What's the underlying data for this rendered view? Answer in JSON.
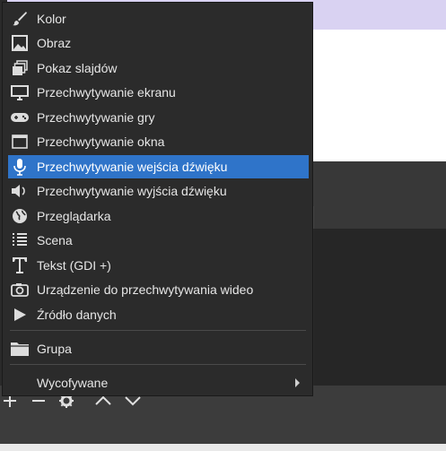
{
  "menu": {
    "items": [
      {
        "label": "Kolor",
        "icon": "brush-icon"
      },
      {
        "label": "Obraz",
        "icon": "image-icon"
      },
      {
        "label": "Pokaz slajdów",
        "icon": "slideshow-icon"
      },
      {
        "label": "Przechwytywanie ekranu",
        "icon": "monitor-icon"
      },
      {
        "label": "Przechwytywanie gry",
        "icon": "gamepad-icon"
      },
      {
        "label": "Przechwytywanie okna",
        "icon": "window-icon"
      },
      {
        "label": "Przechwytywanie wejścia dźwięku",
        "icon": "microphone-icon",
        "highlighted": true
      },
      {
        "label": "Przechwytywanie wyjścia dźwięku",
        "icon": "speaker-icon"
      },
      {
        "label": "Przeglądarka",
        "icon": "globe-icon"
      },
      {
        "label": "Scena",
        "icon": "list-icon"
      },
      {
        "label": "Tekst (GDI +)",
        "icon": "text-icon"
      },
      {
        "label": "Urządzenie do przechwytywania wideo",
        "icon": "camera-icon"
      },
      {
        "label": "Źródło danych",
        "icon": "play-icon"
      }
    ],
    "group": {
      "label": "Grupa",
      "icon": "folder-icon"
    },
    "deprecated": {
      "label": "Wycofywane"
    }
  },
  "colors": {
    "highlight": "#2f74c9",
    "menu_bg": "#2b2b2b",
    "text": "#e6e6e6"
  },
  "toolbar": {
    "icons": [
      "add-icon",
      "remove-icon",
      "settings-icon",
      "move-up-icon",
      "move-down-icon"
    ]
  }
}
